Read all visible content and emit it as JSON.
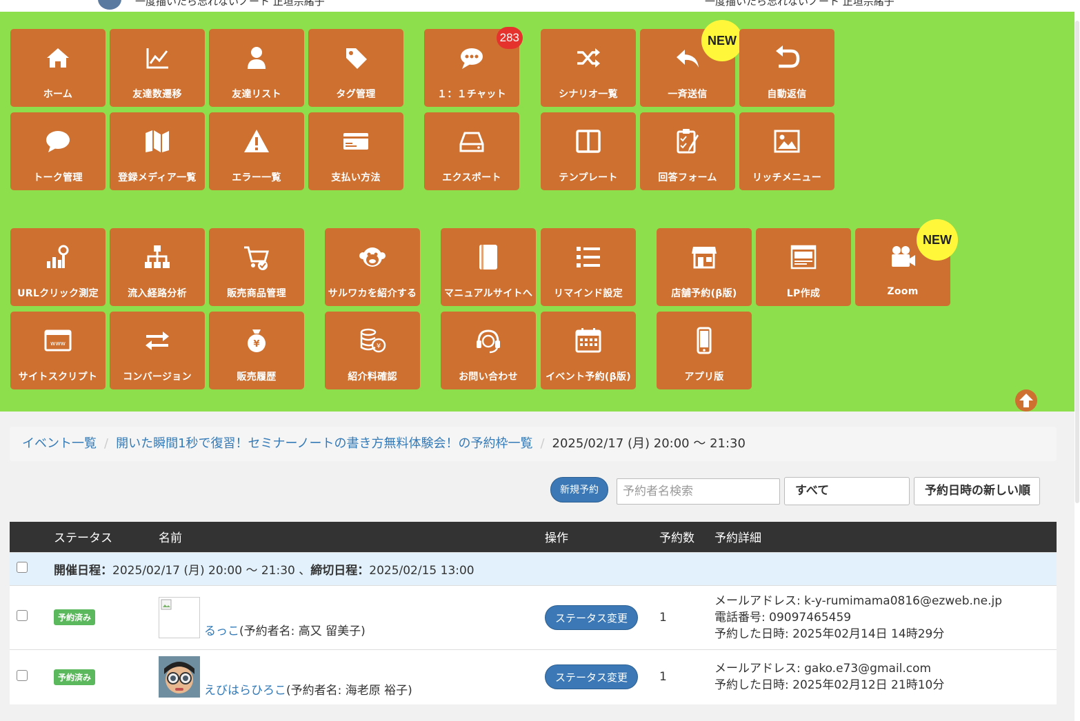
{
  "topbar": {
    "left_text": "一度描いたら忘れないノート 正垣宗緒子",
    "right_text": "一度描いたら忘れないノート 正垣宗緒子"
  },
  "menu": {
    "tiles": [
      {
        "label": "ホーム",
        "icon": "home-icon"
      },
      {
        "label": "友達数遷移",
        "icon": "line-chart-icon"
      },
      {
        "label": "友達リスト",
        "icon": "user-icon"
      },
      {
        "label": "タグ管理",
        "icon": "tags-icon"
      },
      {
        "label": "１：１チャット",
        "icon": "chat-bubble-icon",
        "badge": "283"
      },
      {
        "label": "シナリオ一覧",
        "icon": "shuffle-icon"
      },
      {
        "label": "一斉送信",
        "icon": "reply-icon",
        "new": "NEW"
      },
      {
        "label": "自動返信",
        "icon": "undo-icon"
      },
      {
        "label": "トーク管理",
        "icon": "comment-icon"
      },
      {
        "label": "登録メディア一覧",
        "icon": "map-icon"
      },
      {
        "label": "エラー一覧",
        "icon": "warning-icon"
      },
      {
        "label": "支払い方法",
        "icon": "credit-card-icon"
      },
      {
        "label": "エクスポート",
        "icon": "hdd-icon"
      },
      {
        "label": "テンプレート",
        "icon": "columns-icon"
      },
      {
        "label": "回答フォーム",
        "icon": "clipboard-icon"
      },
      {
        "label": "リッチメニュー",
        "icon": "image-icon"
      },
      {
        "label": "URLクリック測定",
        "icon": "analytics-search-icon"
      },
      {
        "label": "流入経路分析",
        "icon": "sitemap-icon"
      },
      {
        "label": "販売商品管理",
        "icon": "cart-icon"
      },
      {
        "label": "サルワカを紹介する",
        "icon": "monkey-icon"
      },
      {
        "label": "マニュアルサイトへ",
        "icon": "book-icon"
      },
      {
        "label": "リマインド設定",
        "icon": "list-icon"
      },
      {
        "label": "店舗予約(β版)",
        "icon": "store-icon"
      },
      {
        "label": "LP作成",
        "icon": "landing-page-icon"
      },
      {
        "label": "Zoom",
        "icon": "video-camera-icon",
        "new": "NEW"
      },
      {
        "label": "サイトスクリプト",
        "icon": "www-icon"
      },
      {
        "label": "コンバージョン",
        "icon": "exchange-icon"
      },
      {
        "label": "販売履歴",
        "icon": "money-bag-icon"
      },
      {
        "label": "紹介料確認",
        "icon": "coins-icon"
      },
      {
        "label": "お問い合わせ",
        "icon": "headset-icon"
      },
      {
        "label": "イベント予約(β版)",
        "icon": "calendar-icon"
      },
      {
        "label": "アプリ版",
        "icon": "mobile-icon"
      }
    ]
  },
  "breadcrumb": {
    "item1": "イベント一覧",
    "item2": "開いた瞬間1秒で復習！セミナーノートの書き方無料体験会！の予約枠一覧",
    "current": "2025/02/17 (月) 20:00 〜 21:30"
  },
  "toolbar": {
    "new_label": "新規予約",
    "search_placeholder": "予約者名検索",
    "filter_value": "すべて",
    "sort_value": "予約日時の新しい順"
  },
  "table": {
    "headers": [
      "ステータス",
      "名前",
      "操作",
      "予約数",
      "予約詳細"
    ],
    "group": {
      "held_label": "開催日程：",
      "held_value": "2025/02/17 (月) 20:00 〜 21:30 、",
      "deadline_label": "締切日程：",
      "deadline_value": "2025/02/15 13:00"
    },
    "rows": [
      {
        "status": "予約済み",
        "name": "るっこ",
        "reserver": "(予約者名: 高又 留美子)",
        "action": "ステータス変更",
        "count": "1",
        "details": [
          "メールアドレス: k-y-rumimama0816@ezweb.ne.jp",
          "電話番号: 09097465459",
          "予約した日時: 2025年02月14日 14時29分"
        ]
      },
      {
        "status": "予約済み",
        "name": "えびはらひろこ",
        "reserver": "(予約者名: 海老原 裕子)",
        "action": "ステータス変更",
        "count": "1",
        "details": [
          "メールアドレス: gako.e73@gmail.com",
          "予約した日時: 2025年02月12日 21時10分"
        ]
      }
    ]
  }
}
